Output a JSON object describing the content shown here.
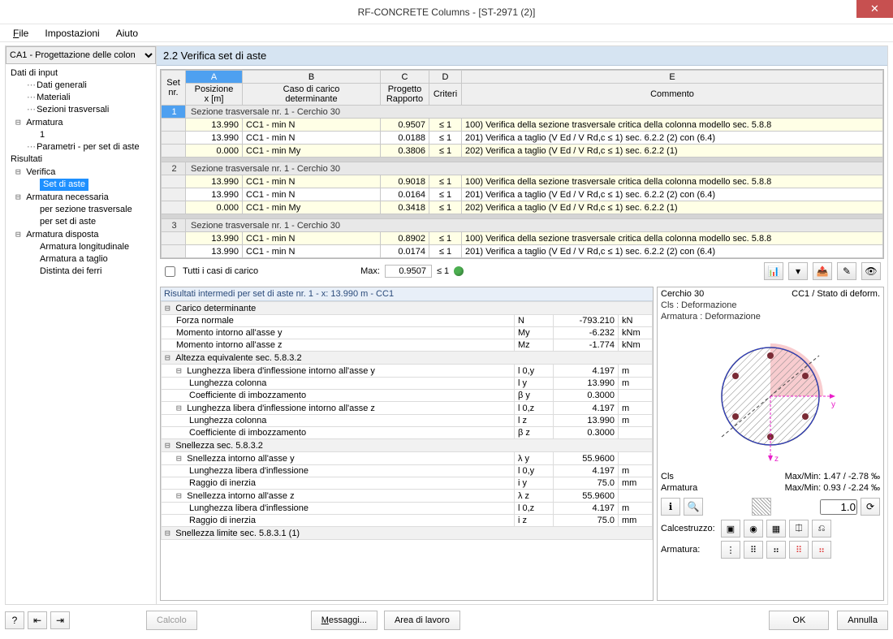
{
  "window": {
    "title": "RF-CONCRETE Columns - [ST-2971 (2)]"
  },
  "menu": {
    "file": "File",
    "settings": "Impostazioni",
    "help": "Aiuto"
  },
  "sidebar": {
    "case_select": "CA1 - Progettazione delle colon",
    "tree": {
      "dati_input": "Dati di input",
      "dati_generali": "Dati generali",
      "materiali": "Materiali",
      "sezioni_trasv": "Sezioni trasversali",
      "armatura": "Armatura",
      "arm_1": "1",
      "parametri": "Parametri - per set di aste",
      "risultati": "Risultati",
      "verifica": "Verifica",
      "set_aste": "Set di aste",
      "armatura_necessaria": "Armatura necessaria",
      "per_sezione": "per sezione trasversale",
      "per_set": "per set di aste",
      "armatura_disposta": "Armatura disposta",
      "arm_long": "Armatura longitudinale",
      "arm_taglio": "Armatura a taglio",
      "distinta": "Distinta dei ferri"
    }
  },
  "main_title": "2.2 Verifica set di aste",
  "grid": {
    "cols": {
      "A": "A",
      "B": "B",
      "C": "C",
      "D": "D",
      "E": "E"
    },
    "hdr": {
      "set": "Set",
      "nr": "nr.",
      "posizione": "Posizione",
      "x": "x [m]",
      "caso": "Caso di carico",
      "det": "determinante",
      "progetto": "Progetto",
      "rapporto": "Rapporto",
      "criteri": "Criteri",
      "commento": "Commento"
    },
    "sect_txt": "Sezione trasversale nr. 1 - Cerchio 30",
    "r1": {
      "x": "13.990",
      "cc": "CC1 - min N",
      "r": "0.9507",
      "c": "≤ 1",
      "cm": "100) Verifica della sezione trasversale critica della colonna modello sec. 5.8.8"
    },
    "r2": {
      "x": "13.990",
      "cc": "CC1 - min N",
      "r": "0.0188",
      "c": "≤ 1",
      "cm": "201) Verifica a taglio (V Ed / V Rd,c ≤ 1) sec. 6.2.2 (2) con (6.4)"
    },
    "r3": {
      "x": "0.000",
      "cc": "CC1 - min My",
      "r": "0.3806",
      "c": "≤ 1",
      "cm": "202) Verifica a taglio (V Ed / V Rd,c ≤ 1) sec. 6.2.2 (1)"
    },
    "r4": {
      "x": "13.990",
      "cc": "CC1 - min N",
      "r": "0.9018",
      "c": "≤ 1",
      "cm": "100) Verifica della sezione trasversale critica della colonna modello sec. 5.8.8"
    },
    "r5": {
      "x": "13.990",
      "cc": "CC1 - min N",
      "r": "0.0164",
      "c": "≤ 1",
      "cm": "201) Verifica a taglio (V Ed / V Rd,c ≤ 1) sec. 6.2.2 (2) con (6.4)"
    },
    "r6": {
      "x": "0.000",
      "cc": "CC1 - min My",
      "r": "0.3418",
      "c": "≤ 1",
      "cm": "202) Verifica a taglio (V Ed / V Rd,c ≤ 1) sec. 6.2.2 (1)"
    },
    "r7": {
      "x": "13.990",
      "cc": "CC1 - min N",
      "r": "0.8902",
      "c": "≤ 1",
      "cm": "100) Verifica della sezione trasversale critica della colonna modello sec. 5.8.8"
    },
    "r8": {
      "x": "13.990",
      "cc": "CC1 - min N",
      "r": "0.0174",
      "c": "≤ 1",
      "cm": "201) Verifica a taglio (V Ed / V Rd,c ≤ 1) sec. 6.2.2 (2) con (6.4)"
    },
    "sec1": "1",
    "sec2": "2",
    "sec3": "3"
  },
  "ctrl": {
    "tutti": "Tutti i casi di carico",
    "max_lbl": "Max:",
    "max_val": "0.9507",
    "crit": "≤ 1"
  },
  "inter": {
    "caption": "Risultati intermedi per set di aste nr. 1 - x: 13.990 m - CC1",
    "carico_det": "Carico determinante",
    "forza_norm": "Forza normale",
    "fn_s": "N",
    "fn_v": "-793.210",
    "fn_u": "kN",
    "mom_y": "Momento intorno all'asse y",
    "my_s": "My",
    "my_v": "-6.232",
    "my_u": "kNm",
    "mom_z": "Momento intorno all'asse z",
    "mz_s": "Mz",
    "mz_v": "-1.774",
    "mz_u": "kNm",
    "alt_eq": "Altezza equivalente sec. 5.8.3.2",
    "lung_y": "Lunghezza libera d'inflessione intorno all'asse y",
    "ly_s": "l 0,y",
    "ly_v": "4.197",
    "ly_u": "m",
    "lung_col1": "Lunghezza colonna",
    "lc1_s": "l y",
    "lc1_v": "13.990",
    "lc1_u": "m",
    "coeff1": "Coefficiente di imbozzamento",
    "c1_s": "β y",
    "c1_v": "0.3000",
    "c1_u": "",
    "lung_z": "Lunghezza libera d'inflessione intorno all'asse z",
    "lz_s": "l 0,z",
    "lz_v": "4.197",
    "lz_u": "m",
    "lung_col2": "Lunghezza colonna",
    "lc2_s": "l z",
    "lc2_v": "13.990",
    "lc2_u": "m",
    "coeff2": "Coefficiente di imbozzamento",
    "c2_s": "β z",
    "c2_v": "0.3000",
    "c2_u": "",
    "snel": "Snellezza sec. 5.8.3.2",
    "sn_y": "Snellezza intorno all'asse y",
    "sny_s": "λ y",
    "sny_v": "55.9600",
    "sny_u": "",
    "sn_lung1": "Lunghezza libera d'inflessione",
    "snl1_s": "l 0,y",
    "snl1_v": "4.197",
    "snl1_u": "m",
    "raggio1": "Raggio di inerzia",
    "r1_s": "i y",
    "r1_v": "75.0",
    "r1_u": "mm",
    "sn_z": "Snellezza intorno all'asse z",
    "snz_s": "λ z",
    "snz_v": "55.9600",
    "snz_u": "",
    "sn_lung2": "Lunghezza libera d'inflessione",
    "snl2_s": "l 0,z",
    "snl2_v": "4.197",
    "snl2_u": "m",
    "raggio2": "Raggio di inerzia",
    "r2_s": "i z",
    "r2_v": "75.0",
    "r2_u": "mm",
    "snel_lim": "Snellezza limite sec. 5.8.3.1 (1)"
  },
  "rp": {
    "title": "Cerchio 30",
    "state": "CC1 / Stato di deform.",
    "cls": "Cls : Deformazione",
    "arm": "Armatura : Deformazione",
    "cls_lbl": "Cls",
    "arm_lbl": "Armatura",
    "cls_mm": "Max/Min: 1.47 / -2.78 ‰",
    "arm_mm": "Max/Min: 0.93 / -2.24 ‰",
    "zoom": "1.0",
    "calc": "Calcestruzzo:",
    "arm2": "Armatura:"
  },
  "bottom": {
    "calcolo": "Calcolo",
    "messaggi": "Messaggi...",
    "area": "Area di lavoro",
    "ok": "OK",
    "annulla": "Annulla"
  }
}
